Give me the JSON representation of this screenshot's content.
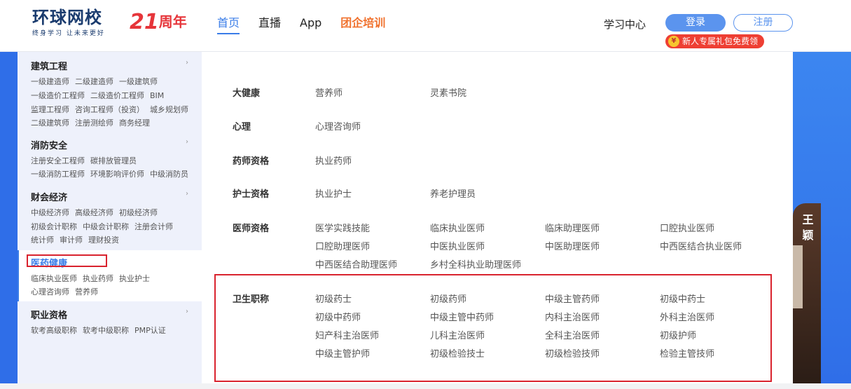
{
  "header": {
    "logo_main": "环球网校",
    "logo_sub": "终身学习 让未来更好",
    "anniversary_num": "21",
    "anniversary_text": "周年",
    "nav": [
      "首页",
      "直播",
      "App",
      "团企培训"
    ],
    "study_center": "学习中心",
    "login": "登录",
    "register": "注册",
    "gift": "新人专属礼包免费领",
    "gift_coin": "¥"
  },
  "banner": {
    "name_vertical": "王颖"
  },
  "sidebar": {
    "categories": [
      {
        "title": "建筑工程",
        "rows": [
          [
            "一级建造师",
            "二级建造师",
            "一级建筑师"
          ],
          [
            "一级造价工程师",
            "二级造价工程师",
            "BIM"
          ],
          [
            "监理工程师",
            "咨询工程师（投资）",
            "城乡规划师"
          ],
          [
            "二级建筑师",
            "注册测绘师",
            "商务经理"
          ]
        ]
      },
      {
        "title": "消防安全",
        "rows": [
          [
            "注册安全工程师",
            "碳排放管理员"
          ],
          [
            "一级消防工程师",
            "环境影响评价师",
            "中级消防员"
          ]
        ]
      },
      {
        "title": "财会经济",
        "rows": [
          [
            "中级经济师",
            "高级经济师",
            "初级经济师"
          ],
          [
            "初级会计职称",
            "中级会计职称",
            "注册会计师"
          ],
          [
            "统计师",
            "审计师",
            "理财投资"
          ]
        ]
      },
      {
        "title": "医药健康",
        "rows": [
          [
            "临床执业医师",
            "执业药师",
            "执业护士"
          ],
          [
            "心理咨询师",
            "营养师"
          ]
        ]
      },
      {
        "title": "职业资格",
        "rows": [
          [
            "软考高级职称",
            "软考中级职称",
            "PMP认证"
          ]
        ]
      }
    ],
    "arrow": "›"
  },
  "panel": {
    "sections": [
      {
        "label": "大健康",
        "links": [
          "营养师",
          "灵素书院"
        ]
      },
      {
        "label": "心理",
        "links": [
          "心理咨询师"
        ]
      },
      {
        "label": "药师资格",
        "links": [
          "执业药师"
        ]
      },
      {
        "label": "护士资格",
        "links": [
          "执业护士",
          "养老护理员"
        ]
      },
      {
        "label": "医师资格",
        "links": [
          "医学实践技能",
          "临床执业医师",
          "临床助理医师",
          "口腔执业医师",
          "口腔助理医师",
          "中医执业医师",
          "中医助理医师",
          "中西医结合执业医师",
          "中西医结合助理医师",
          "乡村全科执业助理医师"
        ]
      },
      {
        "label": "卫生职称",
        "links": [
          "初级药士",
          "初级药师",
          "中级主管药师",
          "初级中药士",
          "初级中药师",
          "中级主管中药师",
          "内科主治医师",
          "外科主治医师",
          "妇产科主治医师",
          "儿科主治医师",
          "全科主治医师",
          "初级护师",
          "中级主管护师",
          "初级检验技士",
          "初级检验技师",
          "检验主管技师"
        ]
      }
    ]
  },
  "colors": {
    "accent": "#3a7de8",
    "highlight": "#d9232e",
    "brand_orange": "#f0712d",
    "gift_red": "#ee3f33"
  }
}
